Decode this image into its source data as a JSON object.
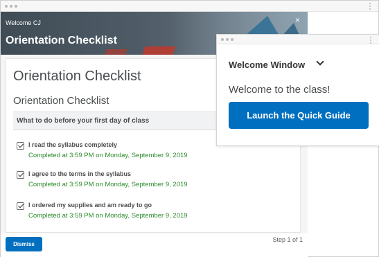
{
  "dialog": {
    "banner": {
      "welcome": "Welcome CJ",
      "title": "Orientation Checklist",
      "close": "×"
    },
    "heading": "Orientation Checklist",
    "subheading": "Orientation Checklist",
    "section_label": "What to do before your first day of class",
    "items": [
      {
        "label": "I read the syllabus completely",
        "status": "Completed at 3:59 PM on Monday, September 9, 2019",
        "checked": true
      },
      {
        "label": "I agree to the terms in the syllabus",
        "status": "Completed at 3:59 PM on Monday, September 9, 2019",
        "checked": true
      },
      {
        "label": "I ordered my supplies and am ready to go",
        "status": "Completed at 3:59 PM on Monday, September 9, 2019",
        "checked": true
      }
    ],
    "footer": {
      "dismiss": "Dismiss",
      "step": "Step 1 of 1"
    }
  },
  "welcome_window": {
    "title": "Welcome Window",
    "message": "Welcome to the class!",
    "launch_button": "Launch the Quick Guide"
  },
  "colors": {
    "primary_button": "#006fbf",
    "completed_text": "#2a8a2a"
  }
}
